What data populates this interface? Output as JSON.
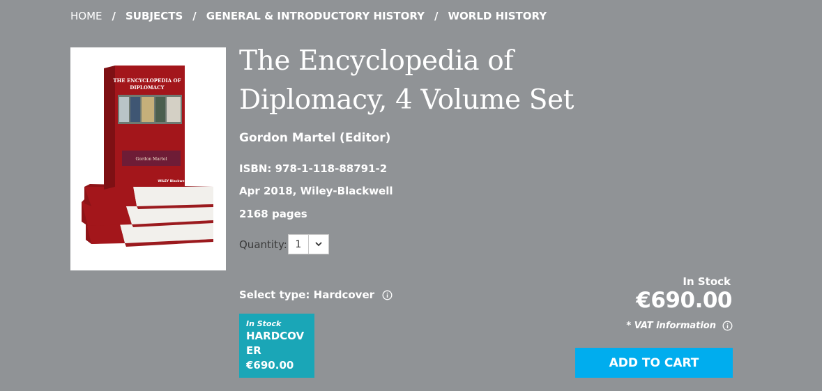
{
  "breadcrumb": {
    "items": [
      "HOME",
      "SUBJECTS",
      "GENERAL & INTRODUCTORY HISTORY",
      "WORLD HISTORY"
    ],
    "separator": "/"
  },
  "product": {
    "title": "The Encyclopedia of Diplomacy, 4 Volume Set",
    "author": "Gordon Martel (Editor)",
    "isbn": "ISBN: 978-1-118-88791-2",
    "pubdate": "Apr 2018, Wiley-Blackwell",
    "pages": "2168 pages",
    "cover": {
      "spine_title": "THE ENCYCLOPEDIA OF DIPLOMACY",
      "editor_line": "Gordon Martel",
      "publisher_logo": "WILEY Blackwell"
    }
  },
  "quantity": {
    "label": "Quantity:",
    "value": "1"
  },
  "select_type": {
    "label": "Select type: Hardcover"
  },
  "type_card": {
    "stock": "In Stock",
    "type": "HARDCOVER",
    "price": "€690.00"
  },
  "purchase": {
    "stock_status": "In Stock",
    "price": "€690.00",
    "vat": "* VAT information",
    "add_to_cart": "ADD TO CART"
  },
  "colors": {
    "background": "#909396",
    "card": "#1aa6b7",
    "cart_button": "#00adee",
    "book_red": "#a3161b"
  },
  "icons": [
    "chevron-down-icon",
    "info-icon"
  ]
}
